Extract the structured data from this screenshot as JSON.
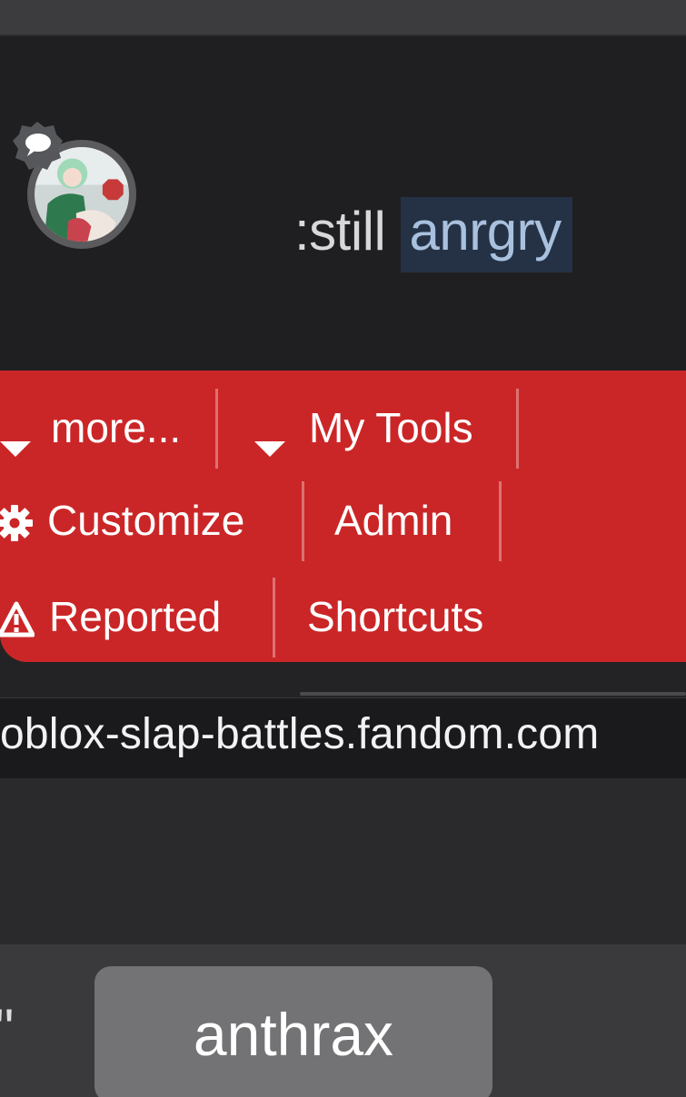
{
  "chat": {
    "message_prefix": ":still ",
    "message_highlight": "anrgry"
  },
  "toolbar": {
    "rows": [
      [
        {
          "icon": "caret-down-icon",
          "label": "more..."
        },
        {
          "icon": "caret-down-icon",
          "label": "My Tools"
        }
      ],
      [
        {
          "icon": "gear-icon",
          "label": "Customize"
        },
        {
          "icon": "",
          "label": "Admin"
        }
      ],
      [
        {
          "icon": "warning-icon",
          "label": "Reported"
        },
        {
          "icon": "",
          "label": "Shortcuts"
        }
      ]
    ]
  },
  "browser": {
    "url": "oblox-slap-battles.fandom.com"
  },
  "keyboard": {
    "suggestion_left": "\"",
    "suggestion_center": "anthrax"
  },
  "colors": {
    "toolbar_bg": "#cb2627",
    "highlight_bg": "#253245",
    "highlight_text": "#a9c1de"
  }
}
